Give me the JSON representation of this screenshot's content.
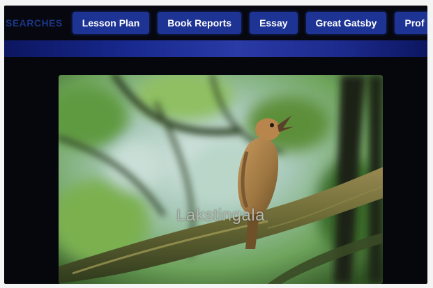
{
  "nav": {
    "label": "SEARCHES",
    "items": [
      "Lesson Plan",
      "Book Reports",
      "Essay",
      "Great Gatsby",
      "Prof"
    ]
  },
  "video": {
    "caption": "Lakstingala",
    "subject": "singing bird on a mossy branch"
  },
  "colors": {
    "nav_background": "#07080f",
    "pill": "#1e3494",
    "band": "#1f2f9a"
  }
}
